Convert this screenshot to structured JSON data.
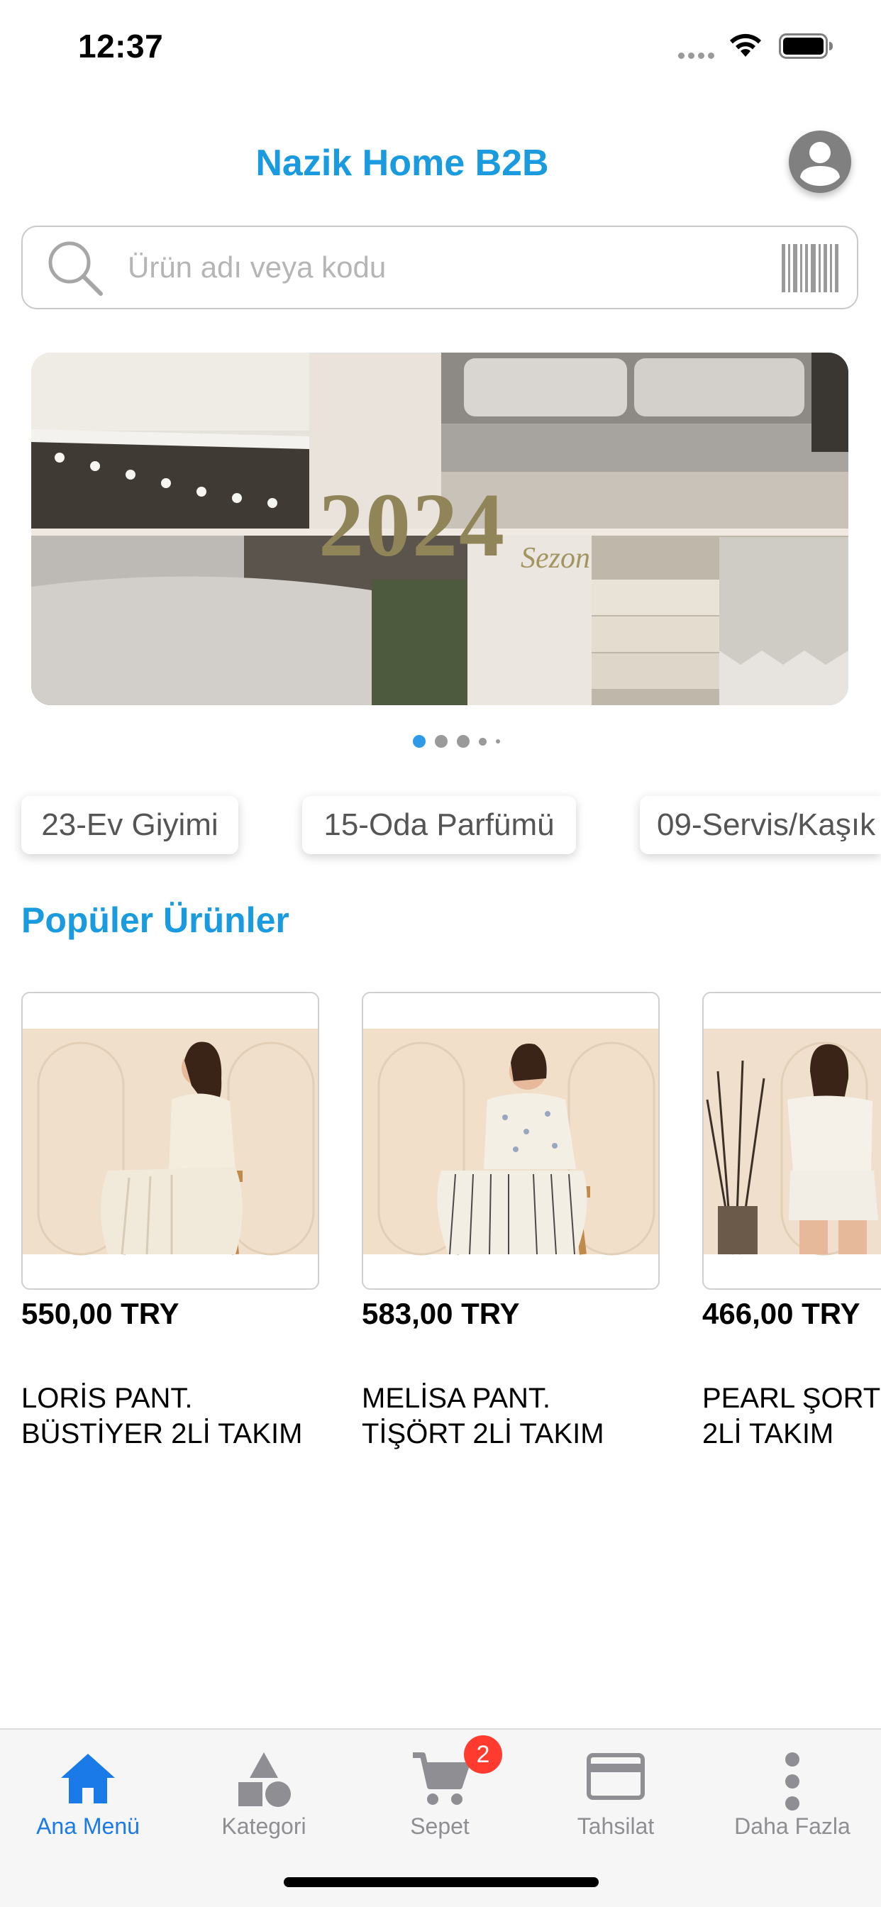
{
  "status_bar": {
    "time": "12:37"
  },
  "header": {
    "title": "Nazik Home B2B"
  },
  "search": {
    "placeholder": "Ürün adı veya kodu"
  },
  "banner": {
    "year": "2024",
    "subtitle": "Sezon",
    "page_count": 5,
    "active_page": 1
  },
  "categories": [
    "23-Ev Giyimi",
    "15-Oda Parfümü",
    "09-Servis/Kaşık"
  ],
  "popular": {
    "title": "Popüler Ürünler",
    "products": [
      {
        "price": "550,00 TRY",
        "name_line1": "LORİS PANT.",
        "name_line2": "BÜSTİYER 2Lİ TAKIM"
      },
      {
        "price": "583,00 TRY",
        "name_line1": "MELİSA PANT.",
        "name_line2": "TİŞÖRT 2Lİ TAKIM"
      },
      {
        "price": "466,00 TRY",
        "name_line1": "PEARL ŞORT",
        "name_line2": "2Lİ TAKIM"
      }
    ]
  },
  "tabbar": {
    "tabs": [
      {
        "label": "Ana Menü",
        "icon": "home-icon",
        "active": true
      },
      {
        "label": "Kategori",
        "icon": "shapes-icon",
        "active": false
      },
      {
        "label": "Sepet",
        "icon": "cart-icon",
        "active": false
      },
      {
        "label": "Tahsilat",
        "icon": "credit-card-icon",
        "active": false
      },
      {
        "label": "Daha Fazla",
        "icon": "more-vertical-icon",
        "active": false
      }
    ],
    "cart_badge": "2"
  },
  "colors": {
    "accent": "#1a9be0",
    "active_tab": "#1a7ae8",
    "badge": "#ff3b30"
  }
}
